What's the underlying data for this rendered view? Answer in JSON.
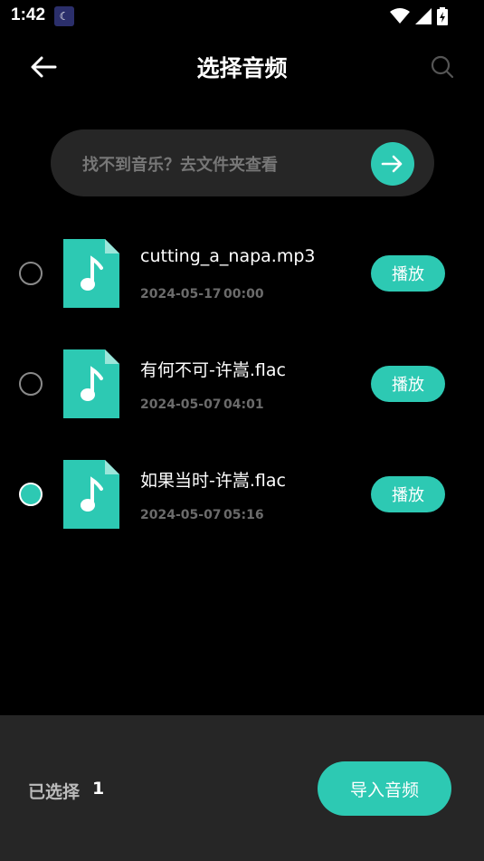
{
  "status_bar": {
    "time": "1:42",
    "app_icon": "moon-app-icon"
  },
  "header": {
    "title": "选择音频"
  },
  "banner": {
    "text": "找不到音乐？去文件夹查看"
  },
  "files": [
    {
      "name": "cutting_a_napa.mp3",
      "date": "2024-05-17",
      "duration": "00:00",
      "selected": false,
      "play_label": "播放"
    },
    {
      "name": "有何不可-许嵩.flac",
      "date": "2024-05-07",
      "duration": "04:01",
      "selected": false,
      "play_label": "播放"
    },
    {
      "name": "如果当时-许嵩.flac",
      "date": "2024-05-07",
      "duration": "05:16",
      "selected": true,
      "play_label": "播放"
    }
  ],
  "footer": {
    "selected_label": "已选择",
    "selected_count": "1",
    "import_label": "导入音频"
  },
  "colors": {
    "accent": "#2dc9b3",
    "background": "#000000",
    "panel": "#262626"
  }
}
